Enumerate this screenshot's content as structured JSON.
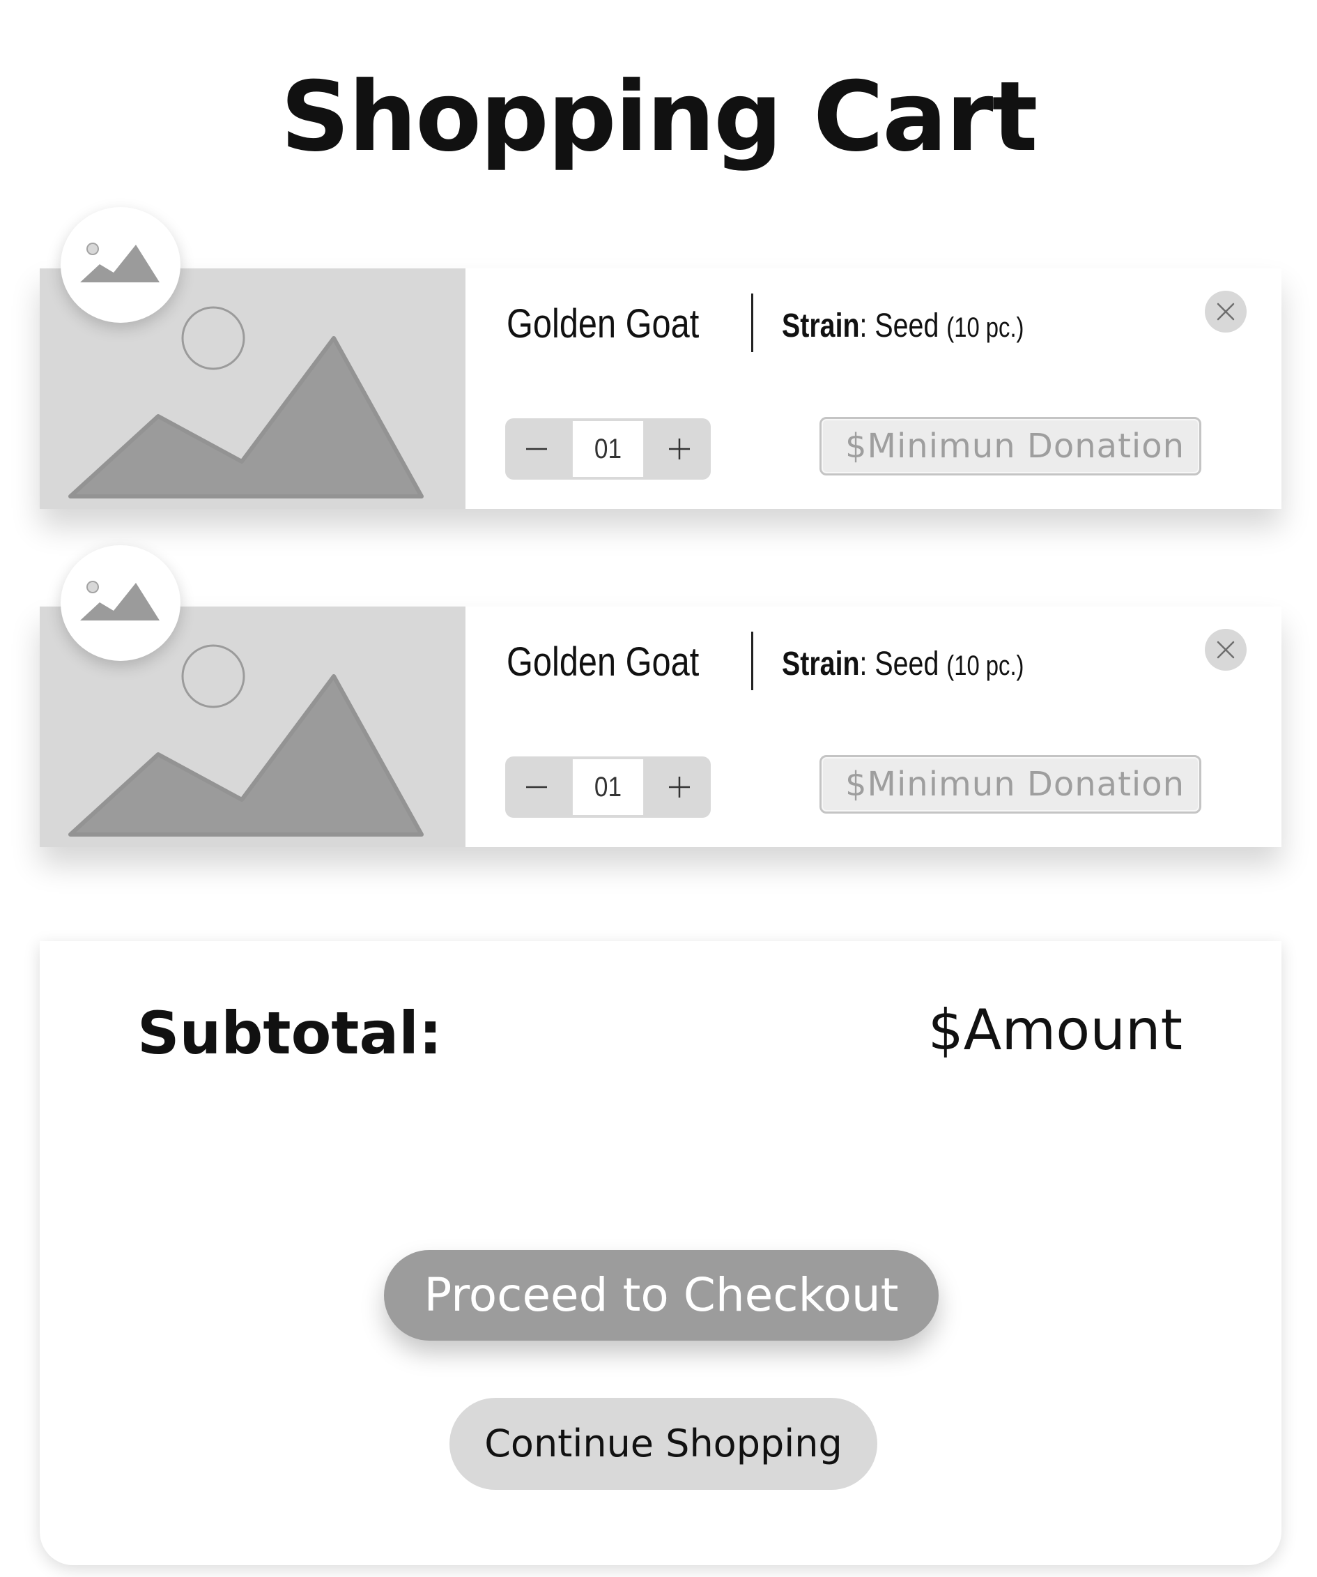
{
  "page": {
    "title": "Shopping Cart"
  },
  "cart": {
    "items": [
      {
        "name": "Golden Goat",
        "strain_label": "Strain",
        "strain_value": "Seed",
        "strain_qty": "(10 pc.)",
        "quantity": "01",
        "donation_placeholder": "$Minimun Donation",
        "image_icon": "image-placeholder-icon"
      },
      {
        "name": "Golden Goat",
        "strain_label": "Strain",
        "strain_value": "Seed",
        "strain_qty": "(10 pc.)",
        "quantity": "01",
        "donation_placeholder": "$Minimun Donation",
        "image_icon": "image-placeholder-icon"
      }
    ]
  },
  "summary": {
    "subtotal_label": "Subtotal:",
    "subtotal_amount": "$Amount",
    "checkout_label": "Proceed to Checkout",
    "continue_label": "Continue Shopping"
  },
  "icons": {
    "remove": "close-icon",
    "decrement": "minus-icon",
    "increment": "plus-icon"
  },
  "colors": {
    "placeholder_gray": "#d8d8d8",
    "mountain_gray": "#9b9b9b",
    "checkout_button": "#9c9c9c",
    "continue_button": "#d9d9d9",
    "text_dark": "#111111"
  }
}
